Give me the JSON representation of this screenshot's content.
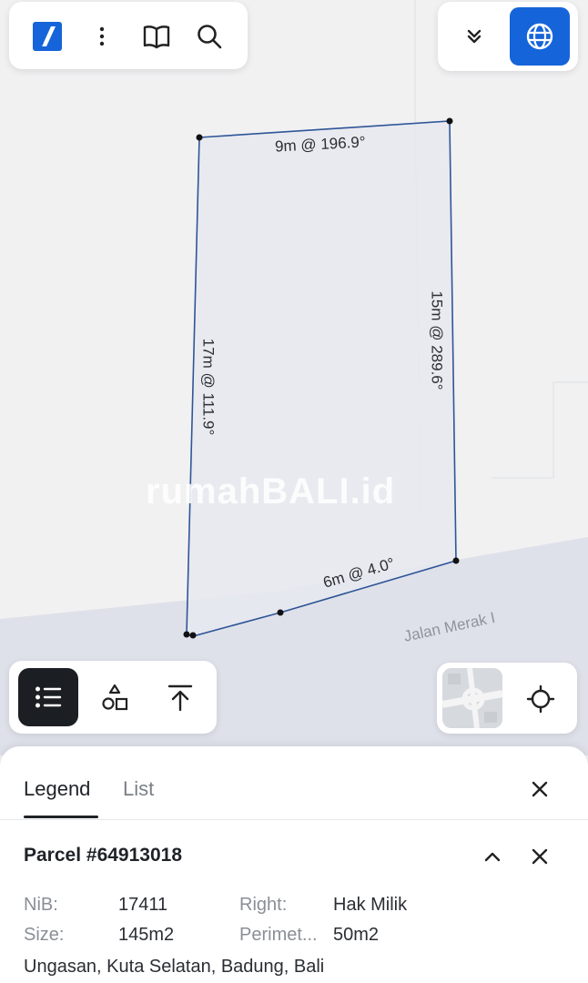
{
  "top_toolbar": {
    "icons": [
      "app-logo-icon",
      "more-vertical-icon",
      "book-open-icon",
      "search-icon"
    ]
  },
  "top_right": {
    "icons": [
      "chevron-double-down-icon",
      "globe-icon"
    ],
    "accent_color": "#1664d9"
  },
  "map": {
    "watermark": "rumahBALI.id",
    "street_name": "Jalan Merak I",
    "parcel_outline_color": "#2f5597",
    "parcel_fill_color": "#e6e9f0",
    "segments": {
      "top": "9m @ 196.9°",
      "right": "15m @ 289.6°",
      "bottom": "6m @ 4.0°",
      "left": "17m @ 111.9°"
    }
  },
  "bottom_toolbar": {
    "icons": [
      "list-icon",
      "shapes-icon",
      "upload-icon"
    ],
    "active": "list-icon"
  },
  "map_controls": {
    "icons": [
      "minimap-thumbnail",
      "locate-crosshair-icon"
    ]
  },
  "sheet": {
    "tabs": [
      {
        "label": "Legend",
        "active": true
      },
      {
        "label": "List",
        "active": false
      }
    ],
    "parcel": {
      "title": "Parcel #64913018",
      "fields": {
        "nib_label": "NiB:",
        "nib_value": "17411",
        "size_label": "Size:",
        "size_value": "145m2",
        "right_label": "Right:",
        "right_value": "Hak Milik",
        "perimeter_label": "Perimet...",
        "perimeter_value": "50m2"
      },
      "address": "Ungasan, Kuta Selatan, Badung, Bali"
    }
  }
}
